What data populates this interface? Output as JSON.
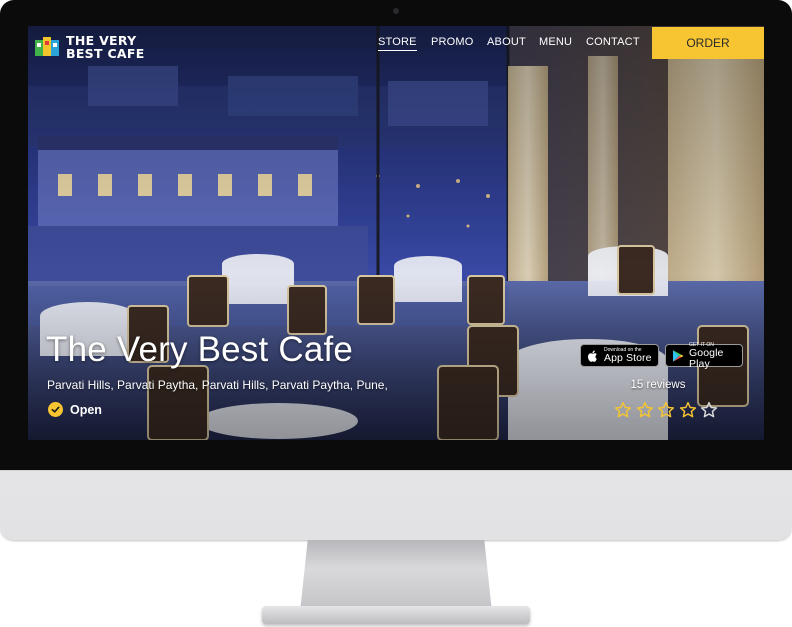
{
  "site": {
    "logo_line1": "THE VERY",
    "logo_line2": "BEST CAFE",
    "logo_icon": "cafe-logo-icon"
  },
  "nav": {
    "items": [
      "STORE",
      "PROMO",
      "ABOUT",
      "MENU",
      "CONTACT"
    ],
    "active": "STORE",
    "order_label": "ORDER"
  },
  "hero": {
    "title": "The Very Best Cafe",
    "address": "Parvati Hills, Parvati Paytha, Parvati Hills, Parvati Paytha, Pune,",
    "status": "Open",
    "status_icon": "check-circle-icon"
  },
  "apps": {
    "app_store_small": "Download on the",
    "app_store_big": "App Store",
    "google_small": "GET IT ON",
    "google_big": "Google Play"
  },
  "rating": {
    "reviews": "15 reviews",
    "stars": 4,
    "max_stars": 5
  },
  "colors": {
    "accent": "#f6c531",
    "bezel": "#0b0b0c",
    "text": "#ffffff"
  }
}
